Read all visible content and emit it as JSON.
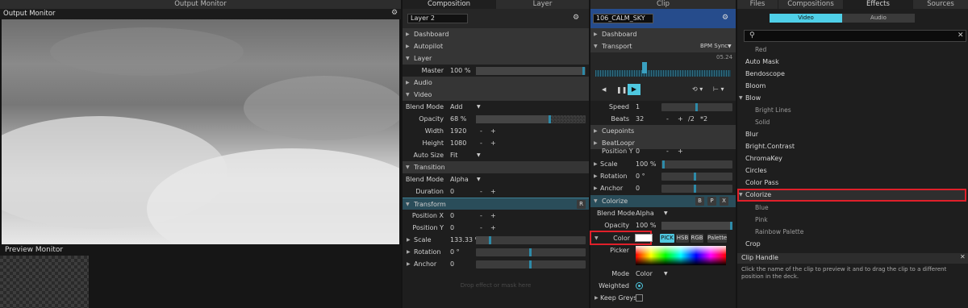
{
  "output_monitor": {
    "header": "Output Monitor",
    "title": "Output Monitor"
  },
  "preview_monitor": {
    "title": "Preview Monitor"
  },
  "layer_panel": {
    "tabs": [
      "Composition",
      "Layer"
    ],
    "name_value": "Layer 2",
    "sections": {
      "dashboard": "Dashboard",
      "autopilot": "Autopilot",
      "layer": "Layer",
      "audio": "Audio",
      "video": "Video",
      "transition": "Transition",
      "transform": "Transform"
    },
    "master": {
      "label": "Master",
      "value": "100 %",
      "level": 0.99
    },
    "blend_mode": {
      "label": "Blend Mode",
      "value": "Add"
    },
    "opacity": {
      "label": "Opacity",
      "value": "68 %",
      "level": 0.68
    },
    "width": {
      "label": "Width",
      "value": "1920"
    },
    "height": {
      "label": "Height",
      "value": "1080"
    },
    "auto_size": {
      "label": "Auto Size",
      "value": "Fit"
    },
    "t_blend_mode": {
      "label": "Blend Mode",
      "value": "Alpha"
    },
    "duration": {
      "label": "Duration",
      "value": "0"
    },
    "position_x": {
      "label": "Position X",
      "value": "0"
    },
    "position_y": {
      "label": "Position Y",
      "value": "0"
    },
    "scale": {
      "label": "Scale",
      "value": "133.33 %"
    },
    "rotation": {
      "label": "Rotation",
      "value": "0 °"
    },
    "anchor": {
      "label": "Anchor",
      "value": "0"
    },
    "drop_hint": "Drop effect or mask here",
    "minus": "-",
    "plus": "+",
    "r_btn": "R"
  },
  "clip_panel": {
    "header": "Clip",
    "clip_name": "106_CALM_SKY",
    "dashboard": "Dashboard",
    "transport": {
      "label": "Transport",
      "sync": "BPM Sync",
      "time": "05.24"
    },
    "speed": {
      "label": "Speed",
      "value": "1"
    },
    "beats": {
      "label": "Beats",
      "value": "32",
      "minus": "-",
      "plus": "+",
      "div": "/2",
      "mul": "*2"
    },
    "cuepoints": "Cuepoints",
    "beatloopr": "BeatLoopr",
    "position_y": {
      "label": "Position Y",
      "value": "0"
    },
    "scale": {
      "label": "Scale",
      "value": "100 %"
    },
    "rotation": {
      "label": "Rotation",
      "value": "0 °"
    },
    "anchor": {
      "label": "Anchor",
      "value": "0"
    },
    "colorize": {
      "label": "Colorize",
      "b": "B",
      "p": "P",
      "x": "X"
    },
    "blend_mode": {
      "label": "Blend Mode",
      "value": "Alpha"
    },
    "opacity": {
      "label": "Opacity",
      "value": "100 %"
    },
    "color": {
      "label": "Color",
      "modes": [
        "PICK",
        "HSB",
        "RGB"
      ],
      "palette": "Palette"
    },
    "picker": {
      "label": "Picker"
    },
    "mode": {
      "label": "Mode",
      "value": "Color"
    },
    "weighted": {
      "label": "Weighted"
    },
    "keep_greys": {
      "label": "Keep Greys"
    }
  },
  "right_panel": {
    "tabs": [
      "Files",
      "Compositions",
      "Effects",
      "Sources"
    ],
    "filters": [
      "Video",
      "Audio"
    ],
    "search_placeholder": "",
    "effects": [
      {
        "label": "Red",
        "sub": true
      },
      {
        "label": "Auto Mask",
        "sub": false
      },
      {
        "label": "Bendoscope",
        "sub": false
      },
      {
        "label": "Bloom",
        "sub": false
      },
      {
        "label": "Blow",
        "sub": false,
        "group": true
      },
      {
        "label": "Bright Lines",
        "sub": true
      },
      {
        "label": "Solid",
        "sub": true
      },
      {
        "label": "Blur",
        "sub": false
      },
      {
        "label": "Bright.Contrast",
        "sub": false
      },
      {
        "label": "ChromaKey",
        "sub": false
      },
      {
        "label": "Circles",
        "sub": false
      },
      {
        "label": "Color Pass",
        "sub": false
      },
      {
        "label": "Colorize",
        "sub": false,
        "group": true
      },
      {
        "label": "Blue",
        "sub": true
      },
      {
        "label": "Pink",
        "sub": true
      },
      {
        "label": "Rainbow Palette",
        "sub": true
      },
      {
        "label": "Crop",
        "sub": false
      }
    ],
    "clip_handle": {
      "title": "Clip Handle",
      "text": "Click the name of the clip to preview it and to drag the clip to a different position in the deck."
    }
  },
  "colors": {
    "accent": "#2e8aa8",
    "highlight": "#e0202a",
    "tab_active": "#4fd0e8"
  }
}
